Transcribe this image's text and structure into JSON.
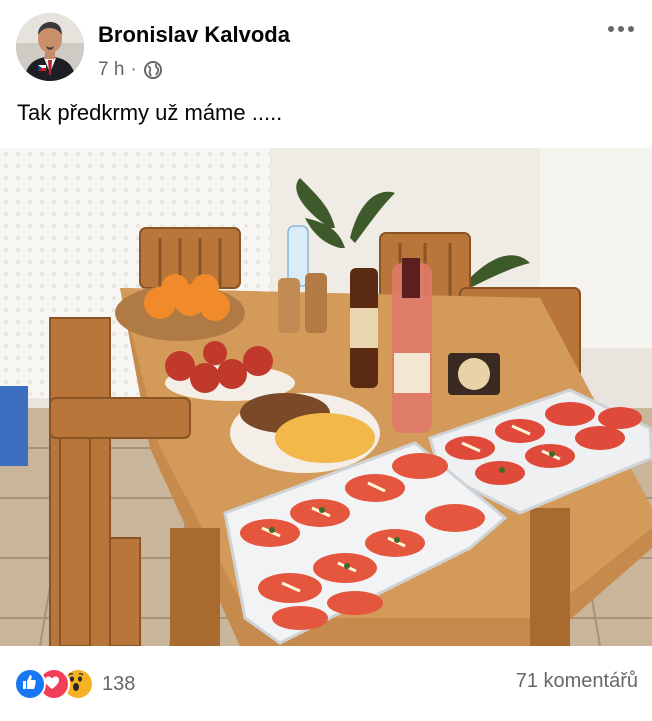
{
  "post": {
    "author": "Bronislav Kalvoda",
    "time": "7 h",
    "separator": "·",
    "audience_icon": "globe-icon",
    "more_icon": "more-dots-icon",
    "text": "Tak předkrmy už máme .....",
    "photo_subject": "table-with-appetizers-photo"
  },
  "footer": {
    "reaction_icons": [
      "like-icon",
      "love-icon",
      "wow-icon"
    ],
    "reaction_count": "138",
    "comments": "71 komentářů"
  },
  "colors": {
    "like": "#1877f2",
    "love": "#f33e58",
    "wow": "#f7b125",
    "secondary_text": "#65676b"
  }
}
